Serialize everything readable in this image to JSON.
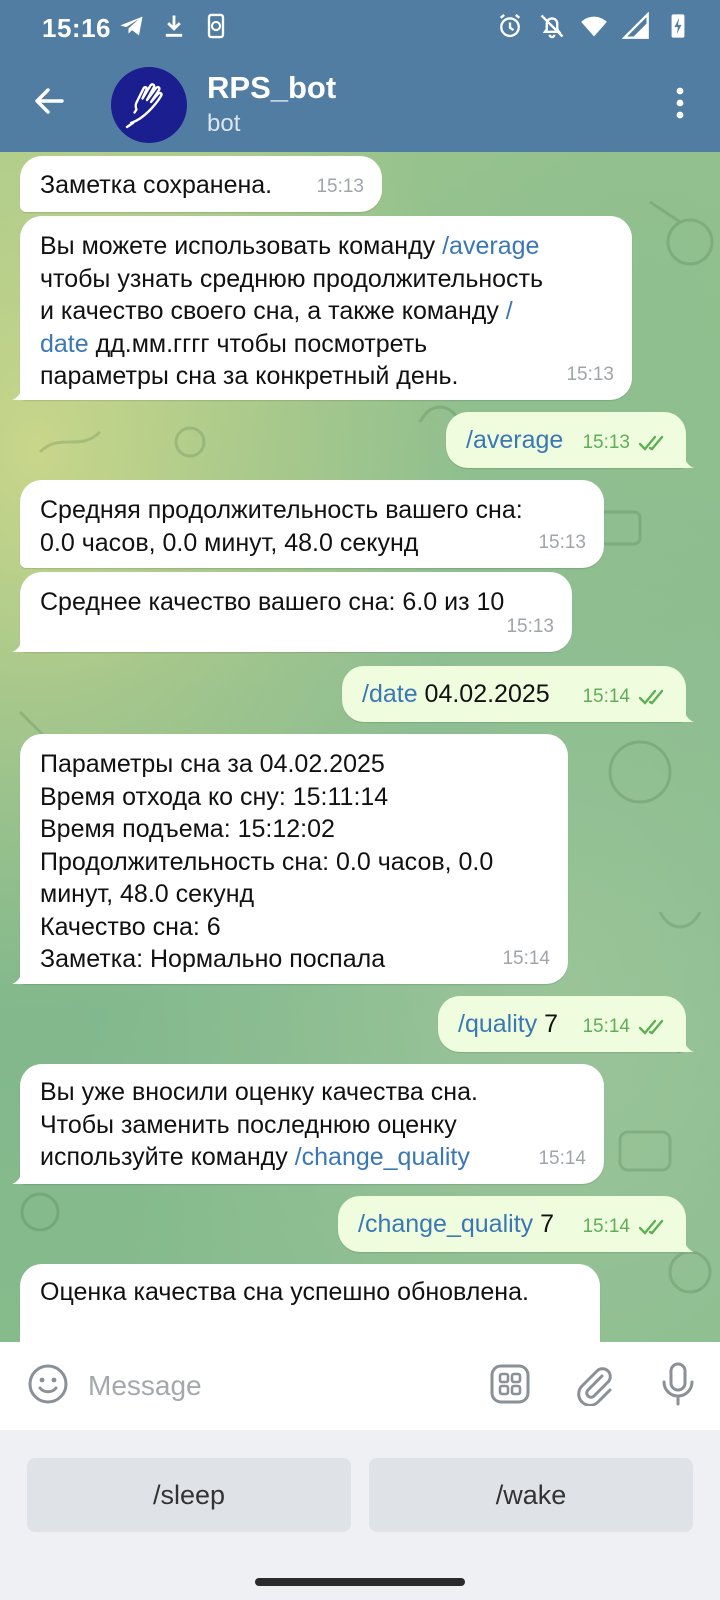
{
  "status_bar": {
    "time": "15:16",
    "left_icons": [
      "telegram-icon",
      "download-icon",
      "phone-sync-icon"
    ],
    "right_icons": [
      "alarm-icon",
      "notifications-off-icon",
      "wifi-icon",
      "signal-icon",
      "battery-charging-icon"
    ]
  },
  "header": {
    "title": "RPS_bot",
    "subtitle": "bot",
    "back_icon": "arrow-left-icon",
    "more_icon": "more-vertical-icon",
    "avatar_icon": "hand-icon",
    "colors": {
      "bar": "#517da2"
    }
  },
  "messages": [
    {
      "dir": "in",
      "text": "Заметка сохранена.",
      "time": "15:13"
    },
    {
      "dir": "in",
      "parts": [
        "Вы можете использовать команду ",
        "/average",
        "\nчтобы узнать среднюю продолжительность\nи качество своего сна, а также команду ",
        "/\ndate",
        " дд.мм.гггг чтобы посмотреть\nпараметры сна за конкретный день."
      ],
      "time": "15:13"
    },
    {
      "dir": "out",
      "cmd": "/average",
      "rest": "",
      "time": "15:13"
    },
    {
      "dir": "in",
      "text": "Средняя продолжительность вашего сна:\n0.0 часов, 0.0 минут, 48.0 секунд",
      "time": "15:13"
    },
    {
      "dir": "in",
      "text": "Среднее качество вашего сна: 6.0 из 10",
      "time": "15:13"
    },
    {
      "dir": "out",
      "cmd": "/date",
      "rest": " 04.02.2025",
      "time": "15:14"
    },
    {
      "dir": "in",
      "text": "Параметры сна за 04.02.2025\nВремя отхода ко сну: 15:11:14\nВремя подъема: 15:12:02\nПродолжительность сна: 0.0 часов, 0.0\nминут, 48.0 секунд\nКачество сна: 6\nЗаметка: Нормально поспала",
      "time": "15:14"
    },
    {
      "dir": "out",
      "cmd": "/quality",
      "rest": " 7",
      "time": "15:14"
    },
    {
      "dir": "in",
      "parts": [
        "Вы уже вносили оценку качества сна.\nЧтобы заменить последнюю оценку\nиспользуйте команду ",
        "/change_quality"
      ],
      "time": "15:14"
    },
    {
      "dir": "out",
      "cmd": "/change_quality",
      "rest": " 7",
      "time": "15:14"
    },
    {
      "dir": "in",
      "text": "Оценка качества сна успешно обновлена.",
      "time": ""
    }
  ],
  "input": {
    "placeholder": "Message",
    "emoji_icon": "emoji-icon",
    "keyboard_icon": "bot-keyboard-icon",
    "attach_icon": "paperclip-icon",
    "mic_icon": "microphone-icon"
  },
  "reply_keyboard": {
    "buttons": [
      "/sleep",
      "/wake"
    ]
  },
  "colors": {
    "link": "#3a78b4",
    "outgoing_bubble": "#effdde",
    "read_checks": "#5fae57"
  }
}
